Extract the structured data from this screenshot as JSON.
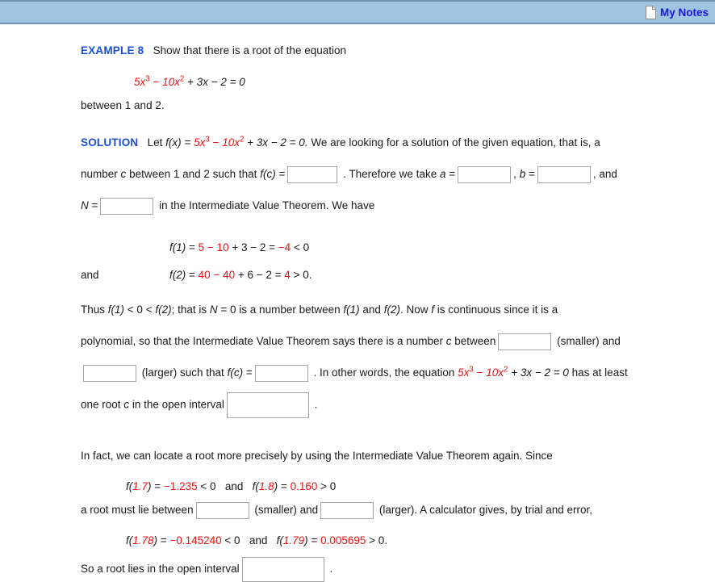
{
  "header": {
    "notes_label": "My Notes",
    "notes_icon": "document-icon",
    "bar_color": "#9fc5e2",
    "link_color": "#1818d0"
  },
  "colors": {
    "accent_blue": "#1a4fd6",
    "math_red": "#ee1111",
    "text": "#1a1a1a",
    "input_border": "#a6a6a6"
  },
  "example": {
    "label": "EXAMPLE 8",
    "prompt": "Show that there is a root of the equation",
    "equation": {
      "t1": "5x",
      "t1_exp": "3",
      "op1": "−",
      "t2": "10x",
      "t2_exp": "2",
      "rest": "+ 3x − 2 = 0"
    },
    "between": "between 1 and 2."
  },
  "solution": {
    "label": "SOLUTION",
    "lead_a": "Let",
    "lead_fx": "f(x)",
    "lead_eq": "=",
    "eq_t1": "5x",
    "eq_t1_exp": "3",
    "eq_op1": "−",
    "eq_t2": "10x",
    "eq_t2_exp": "2",
    "eq_rest": "+ 3x − 2 = 0.",
    "lead_b": "We are looking for a solution of the given equation, that is, a",
    "line2_a": "number",
    "line2_c": "c",
    "line2_b": "between 1 and 2 such that",
    "line2_fc": "f(c)",
    "line2_eq": "=",
    "line2_dot": ".",
    "line2_take": "Therefore we take",
    "line2_a_var": "a",
    "line2_eq2": "=",
    "line2_comma1": ",",
    "line2_b_var": "b",
    "line2_eq3": "=",
    "line2_comma2": ", and",
    "line3_N": "N",
    "line3_eq": "=",
    "line3_rest": "in the Intermediate Value Theorem. We have"
  },
  "evaluations": [
    {
      "name": "f(1)",
      "eq": "=",
      "red1": "5 − 10",
      "black1": "+ 3 − 2 =",
      "red2": "−4",
      "black2": "< 0",
      "prefix": ""
    },
    {
      "name": "f(2)",
      "eq": "=",
      "red1": "40 − 40",
      "black1": "+ 6 − 2 =",
      "red2": "4",
      "black2": "> 0.",
      "prefix": "and"
    }
  ],
  "thus": {
    "t1": "Thus",
    "f1": "f(1)",
    "t2": "< 0 <",
    "f2": "f(2)",
    "t3": "; that is",
    "N": "N",
    "t4": "= 0 is a number between",
    "f3": "f(1)",
    "t5": "and",
    "f4": "f(2)",
    "t6": ". Now",
    "f5": "f",
    "t7": "is continuous since it is a",
    "line2_a": "polynomial, so that the Intermediate Value Theorem says there is a number",
    "line2_c": "c",
    "line2_b": "between",
    "smaller": "(smaller) and",
    "larger": "(larger) such that",
    "fc": "f(c)",
    "eq": "=",
    "dot": ".",
    "inother": "In other words, the equation",
    "eq_t1": "5x",
    "eq_t1_exp": "3",
    "eq_op1": "−",
    "eq_t2": "10x",
    "eq_t2_exp": "2",
    "eq_rest": "+ 3x − 2 = 0",
    "atleast": "has at least",
    "lastline_a": "one root",
    "lastline_c": "c",
    "lastline_b": "in the open interval",
    "lastline_dot": "."
  },
  "infact": {
    "intro": "In fact, we can locate a root more precisely by using the Intermediate Value Theorem again. Since",
    "eval1": {
      "f": "f(",
      "arg": "1.7",
      "fclose": ")",
      "eq": "=",
      "value": "−1.235",
      "cmp": "< 0"
    },
    "joiner": "and",
    "eval2": {
      "f": "f(",
      "arg": "1.8",
      "fclose": ")",
      "eq": "=",
      "value": "0.160",
      "cmp": "> 0"
    },
    "between_a": "a root must lie between",
    "between_smaller": "(smaller) and",
    "between_larger": "(larger). A calculator gives, by trial and error,",
    "eval3": {
      "f": "f(",
      "arg": "1.78",
      "fclose": ")",
      "eq": "=",
      "value": "−0.145240",
      "cmp": "< 0"
    },
    "joiner2": "and",
    "eval4": {
      "f": "f(",
      "arg": "1.79",
      "fclose": ")",
      "eq": "=",
      "value": "0.005695",
      "cmp": "> 0."
    },
    "final_a": "So a root lies in the open interval",
    "final_dot": "."
  },
  "inputs": {
    "fc_value": "",
    "a_value": "",
    "b_value": "",
    "N_value": "",
    "c_smaller": "",
    "c_larger": "",
    "fc_result": "",
    "interval_1": "",
    "root_smaller": "",
    "root_larger": "",
    "interval_2": ""
  }
}
